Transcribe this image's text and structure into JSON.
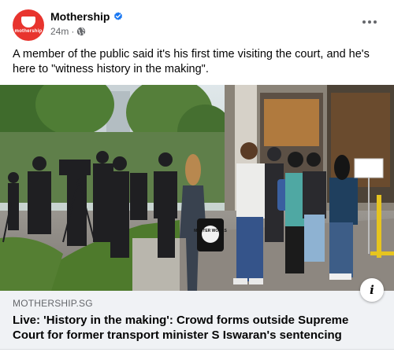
{
  "post": {
    "author": {
      "name": "Mothership",
      "avatar_text": "mothership",
      "verified": true
    },
    "timestamp": "24m",
    "privacy": "globe-icon",
    "caption": "A member of the public said it's his first time visiting the court, and he's here to \"witness history in the making\".",
    "link": {
      "domain": "MOTHERSHIP.SG",
      "title": "Live: 'History in the making': Crowd forms outside Supreme Court for former transport minister S Iswaran's sentencing"
    },
    "photo": {
      "bag_text": "MASTER WORKS"
    }
  },
  "icons": {
    "verified": "verified-badge-icon",
    "privacy": "globe-icon",
    "more": "more-options-icon",
    "info": "info-icon"
  },
  "colors": {
    "brand": "#e8342e",
    "verified": "#1877f2",
    "preview_bg": "#f0f2f5",
    "muted_text": "#65676b"
  }
}
